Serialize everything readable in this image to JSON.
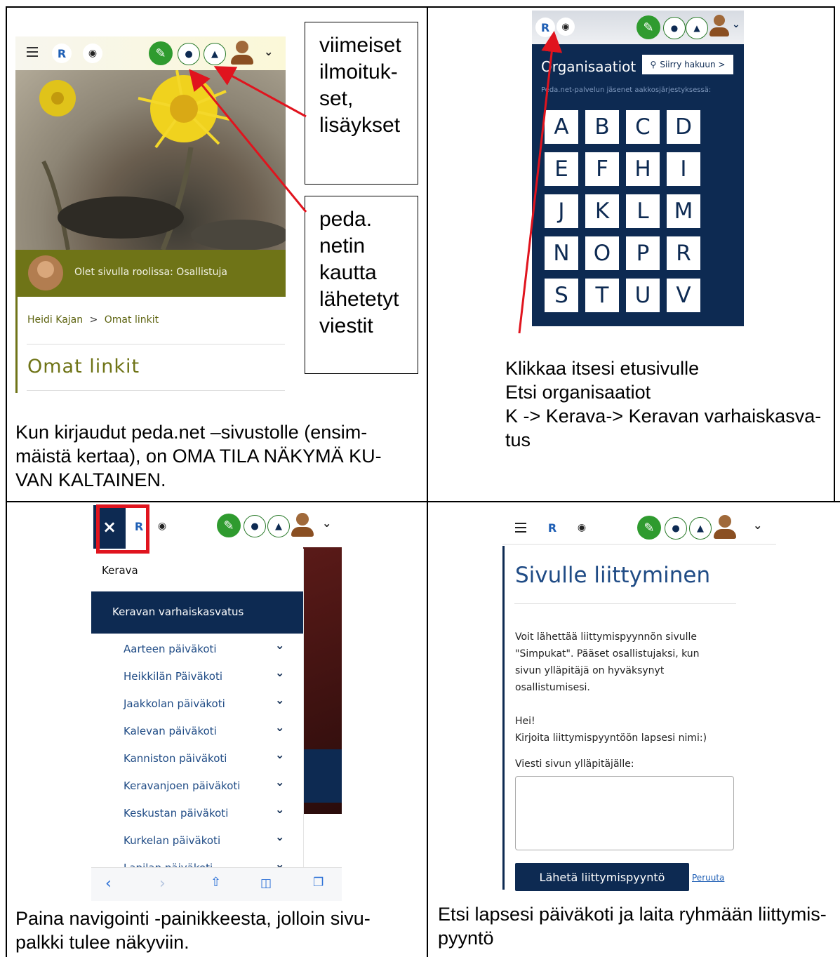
{
  "panel1": {
    "caption_lines": [
      "Kun kirjaudut peda.net –sivustolle (ensim-",
      "mäistä kertaa), on OMA TILA NÄKYMÄ KU-",
      "VAN KALTAINEN."
    ],
    "role_text": "Olet sivulla roolissa: Osallistuja",
    "breadcrumb_user": "Heidi Kajan",
    "breadcrumb_sep": ">",
    "breadcrumb_page": "Omat linkit",
    "page_title": "Omat linkit",
    "callout1_lines": [
      "viimeiset",
      "ilmoituk-",
      "set,",
      "lisäykset"
    ],
    "callout2_lines": [
      "peda.",
      "netin",
      "kautta",
      "lähetetyt",
      "viestit"
    ]
  },
  "panel2": {
    "title": "Organisaatiot",
    "search_button": "Siirry hakuun >",
    "subtitle": "Peda.net-palvelun jäsenet aakkosjärjestyksessä:",
    "letters": [
      "A",
      "B",
      "C",
      "D",
      "E",
      "F",
      "H",
      "I",
      "J",
      "K",
      "L",
      "M",
      "N",
      "O",
      "P",
      "R",
      "S",
      "T",
      "U",
      "V"
    ],
    "caption_lines": [
      "Klikkaa itsesi etusivulle",
      "Etsi organisaatiot",
      "K -> Kerava-> Keravan varhaiskasva-",
      "tus"
    ]
  },
  "panel3": {
    "close_symbol": "×",
    "breadcrumb": "Kerava",
    "active_item": "Keravan varhaiskasvatus",
    "nav_items": [
      "Aarteen päiväkoti",
      "Heikkilän Päiväkoti",
      "Jaakkolan päiväkoti",
      "Kalevan päiväkoti",
      "Kanniston päiväkoti",
      "Keravanjoen päiväkoti",
      "Keskustan päiväkoti",
      "Kurkelan päiväkoti",
      "Lapilan päiväkoti"
    ],
    "caption_lines": [
      "Paina navigointi -painikkeesta, jolloin sivu-",
      "palkki tulee näkyviin."
    ]
  },
  "panel4": {
    "page_title": "Sivulle liittyminen",
    "intro_lines": [
      "Voit lähettää liittymispyynnön sivulle",
      "\"Simpukat\". Pääset osallistujaksi, kun",
      "sivun ylläpitäjä on hyväksynyt",
      "osallistumisesi."
    ],
    "greeting": "Hei!",
    "instruction": "Kirjoita liittymispyyntöön lapsesi nimi:)",
    "message_label": "Viesti sivun ylläpitäjälle:",
    "message_value": "",
    "submit_button": "Lähetä liittymispyyntö",
    "cancel_link": "Peruuta",
    "caption_lines": [
      "Etsi lapsesi päiväkoti ja laita ryhmään liittymis-",
      "pyyntö"
    ]
  },
  "colors": {
    "navy": "#0d2a52",
    "olive": "#6f7417",
    "green": "#2f9b2f",
    "red_annotation": "#e0141e",
    "link_blue": "#1f4b85"
  },
  "icons": [
    "hamburger-icon",
    "peda-logo-icon",
    "user-search-icon",
    "pen-icon",
    "chat-bubble-icon",
    "bell-icon",
    "avatar-icon",
    "chevron-down-icon",
    "close-icon",
    "search-icon",
    "share-icon",
    "book-icon",
    "tabs-icon"
  ]
}
